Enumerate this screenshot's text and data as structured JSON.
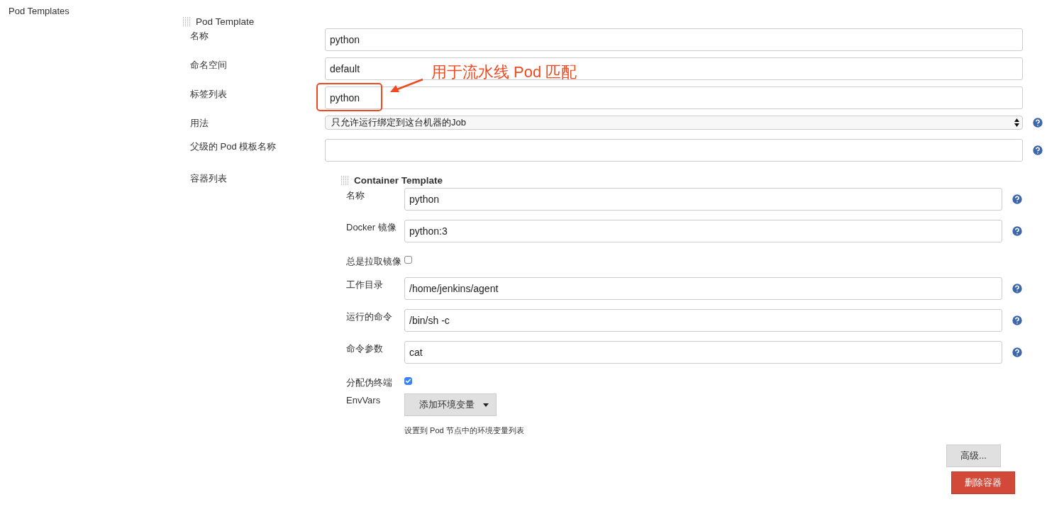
{
  "page_label": "Pod Templates",
  "pod_template": {
    "title": "Pod Template",
    "fields": [
      {
        "label": "名称",
        "kind": "text",
        "value": "python",
        "help": false,
        "highlighted": false
      },
      {
        "label": "命名空间",
        "kind": "text",
        "value": "default",
        "help": false,
        "highlighted": false
      },
      {
        "label": "标签列表",
        "kind": "text",
        "value": "python",
        "help": false,
        "highlighted": true
      },
      {
        "label": "用法",
        "kind": "select",
        "value": "只允许运行绑定到这台机器的Job",
        "help": true,
        "highlighted": false
      },
      {
        "label": "父级的 Pod 模板名称",
        "kind": "text",
        "help": true,
        "highlighted": false
      }
    ],
    "annotation": {
      "text": "用于流水线 Pod 匹配"
    },
    "containers_label": "容器列表",
    "container": {
      "title": "Container Template",
      "fields": [
        {
          "label": "名称",
          "kind": "text",
          "value": "python",
          "help": true
        },
        {
          "label": "Docker 镜像",
          "kind": "text",
          "value": "python:3",
          "help": true
        },
        {
          "label": "总是拉取镜像",
          "kind": "checkbox",
          "checked": false
        },
        {
          "label": "工作目录",
          "kind": "text",
          "value": "/home/jenkins/agent",
          "help": true
        },
        {
          "label": "运行的命令",
          "kind": "text",
          "value": "/bin/sh -c",
          "help": true
        },
        {
          "label": "命令参数",
          "kind": "text",
          "value": "cat",
          "help": true
        },
        {
          "label": "分配伪终端",
          "kind": "checkbox",
          "checked": true
        },
        {
          "label": "EnvVars",
          "kind": "menu_button",
          "button": "添加环境变量",
          "hint": "设置到 Pod 节点中的环境变量列表"
        }
      ],
      "buttons": [
        {
          "label": "高级...",
          "kind": "secondary"
        },
        {
          "label": "删除容器",
          "kind": "danger"
        }
      ]
    }
  }
}
